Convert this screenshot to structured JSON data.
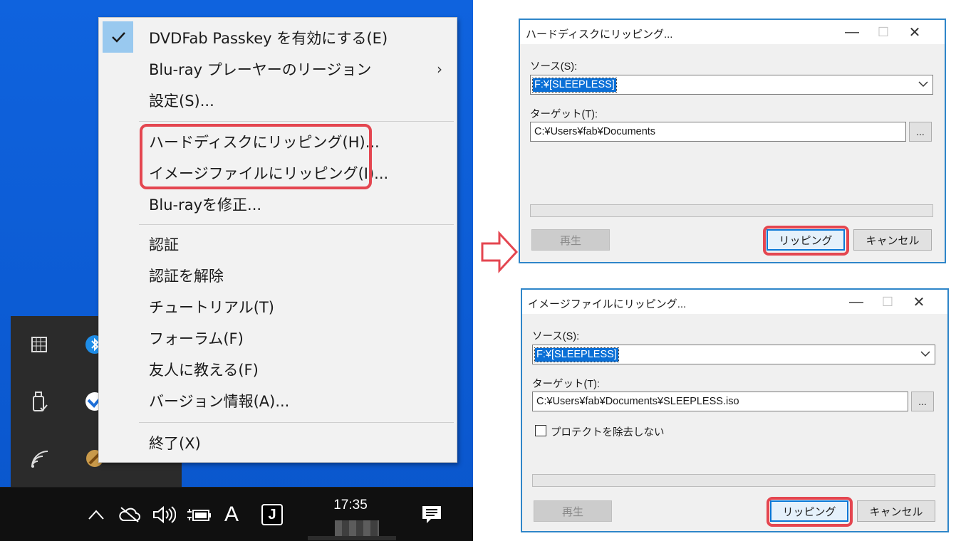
{
  "context_menu": {
    "items": [
      {
        "label": "DVDFab Passkey を有効にする(E)",
        "checked": true
      },
      {
        "label": "Blu-ray プレーヤーのリージョン",
        "submenu_icon": "chevron-right-icon"
      },
      {
        "label": "設定(S)..."
      },
      {
        "label": "ハードディスクにリッピング(H)..."
      },
      {
        "label": "イメージファイルにリッピング(I)..."
      },
      {
        "label": "Blu-rayを修正..."
      },
      {
        "label": "認証"
      },
      {
        "label": "認証を解除"
      },
      {
        "label": "チュートリアル(T)"
      },
      {
        "label": "フォーラム(F)"
      },
      {
        "label": "友人に教える(F)"
      },
      {
        "label": "バージョン情報(A)..."
      },
      {
        "label": "終了(X)"
      }
    ],
    "highlight_color": "#e44650",
    "check_bg_color": "#99c9ef"
  },
  "taskbar": {
    "time": "17:35",
    "ime_label": "A",
    "app_label": "J",
    "icons": [
      "chevron-up-icon",
      "onedrive-offline-icon",
      "speaker-icon",
      "battery-charging-icon",
      "ime-icon",
      "app-icon",
      "notification-icon"
    ]
  },
  "tray_flyout": {
    "icons": [
      "grid-icon",
      "bluetooth-icon",
      "usb-drive-icon",
      "app-icon",
      "wifi-icon",
      "dvdfab-passkey-icon"
    ]
  },
  "dialog_hdd": {
    "title": "ハードディスクにリッピング...",
    "source_label": "ソース(S):",
    "source_value": "F:¥[SLEEPLESS]",
    "target_label": "ターゲット(T):",
    "target_value": "C:¥Users¥fab¥Documents",
    "browse_label": "...",
    "play_button": "再生",
    "rip_button": "リッピング",
    "cancel_button": "キャンセル"
  },
  "dialog_iso": {
    "title": "イメージファイルにリッピング...",
    "source_label": "ソース(S):",
    "source_value": "F:¥[SLEEPLESS]",
    "target_label": "ターゲット(T):",
    "target_value": "C:¥Users¥fab¥Documents¥SLEEPLESS.iso",
    "browse_label": "...",
    "checkbox_label": "プロテクトを除去しない",
    "checkbox_checked": false,
    "play_button": "再生",
    "rip_button": "リッピング",
    "cancel_button": "キャンセル"
  },
  "window_controls": {
    "minimize": "—",
    "maximize": "☐",
    "close": "✕"
  },
  "colors": {
    "desktop": "#0a5cd6",
    "accent": "#0a6fd6",
    "dialog_border": "#2f86c9"
  }
}
